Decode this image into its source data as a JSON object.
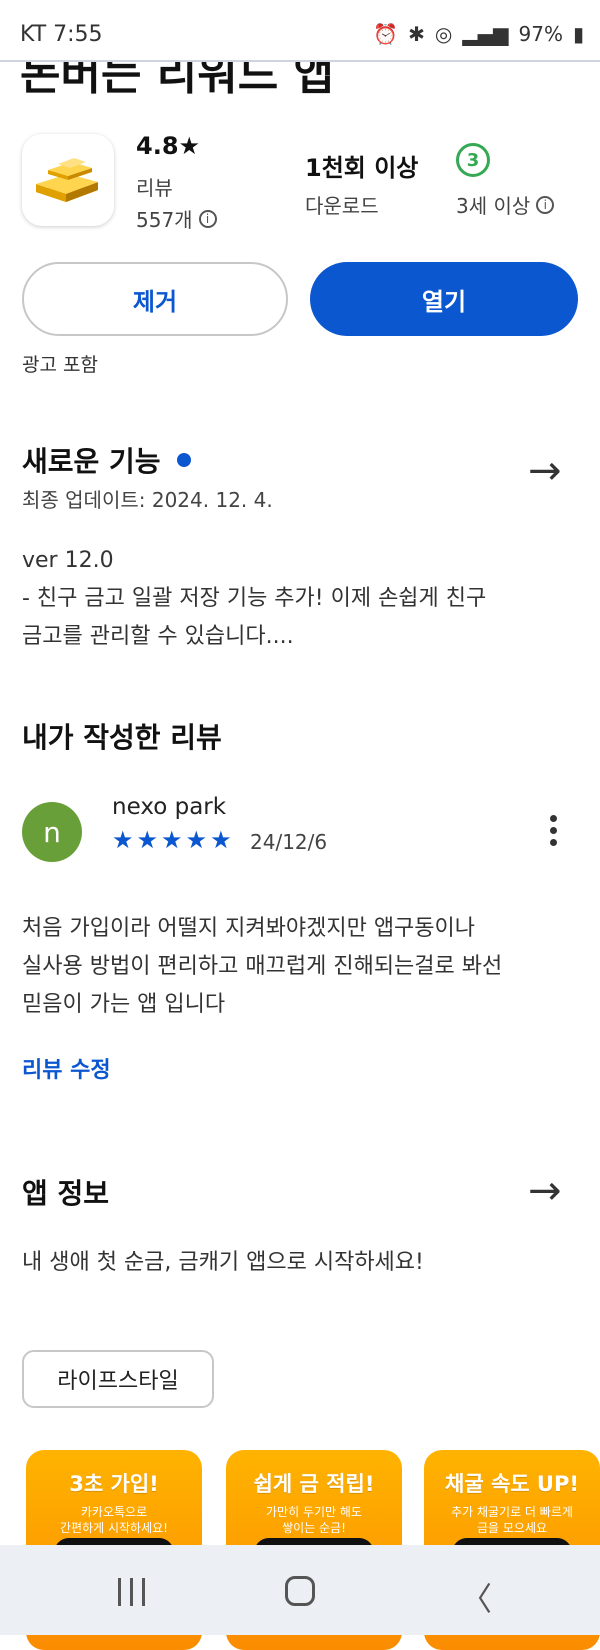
{
  "status_bar": {
    "carrier_time": "KT 7:55",
    "battery": "97%",
    "icons": [
      "alarm-icon",
      "bluetooth-icon",
      "hotspot-icon",
      "hd-icon",
      "5g-icon",
      "signal-icon",
      "battery-icon"
    ]
  },
  "app": {
    "title_cut": "돈버는 리워드 앱",
    "rating": "4.8★",
    "rating_label": "리뷰",
    "review_count": "557개",
    "downloads": "1천회 이상",
    "downloads_label": "다운로드",
    "age_value": "3",
    "age_label": "3세 이상",
    "remove_label": "제거",
    "open_label": "열기",
    "ads_notice": "광고 포함"
  },
  "whats_new": {
    "title": "새로운 기능",
    "updated": "최종 업데이트: 2024. 12. 4.",
    "version": "ver 12.0",
    "line1": "- 친구 금고 일괄 저장 기능 추가! 이제 손쉽게 친구",
    "line2": "금고를 관리할 수 있습니다...."
  },
  "my_review": {
    "title": "내가 작성한 리뷰",
    "avatar_letter": "n",
    "reviewer": "nexo park",
    "stars": 5,
    "date": "24/12/6",
    "line1": "처음 가입이라 어떨지 지켜봐야겠지만 앱구동이나",
    "line2": "실사용 방법이 편리하고 매끄럽게 진해되는걸로 봐선",
    "line3": "믿음이 가는 앱 입니다",
    "edit_label": "리뷰 수정"
  },
  "about": {
    "title": "앱 정보",
    "description": "내 생애 첫 순금, 금캐기 앱으로 시작하세요!",
    "category_chip": "라이프스타일"
  },
  "screenshots": [
    {
      "heading": "3초 가입!",
      "sub1": "카카오톡으로",
      "sub2": "간편하게 시작하세요!"
    },
    {
      "heading": "쉽게 금 적립!",
      "sub1": "가만히 두기만 해도",
      "sub2": "쌓이는 순금!"
    },
    {
      "heading": "채굴 속도 UP!",
      "sub1": "추가 채굴기로 더 빠르게",
      "sub2": "금을 모으세요"
    }
  ],
  "colors": {
    "accent": "#0b57d0",
    "age_green": "#34a853",
    "avatar": "#689f38",
    "screenshot_bg": "#fb8c00"
  }
}
